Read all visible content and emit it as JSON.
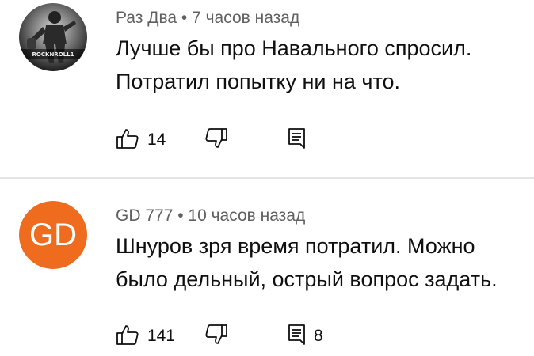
{
  "comments": [
    {
      "author": "Раз Два",
      "separator": "•",
      "time": "7 часов назад",
      "text": "Лучше бы про Навального спросил. Потратил попытку ни на что.",
      "likes": "14",
      "replies": "",
      "avatar": {
        "type": "image",
        "caption": "ROCKNROLL1"
      }
    },
    {
      "author": "GD 777",
      "separator": "•",
      "time": "10 часов назад",
      "text": "Шнуров зря время потратил. Можно было дельный, острый вопрос задать.",
      "likes": "141",
      "replies": "8",
      "avatar": {
        "type": "initials",
        "initials": "GD",
        "color": "#ef6c1f"
      }
    }
  ],
  "icons": {
    "like": "thumb-up-icon",
    "dislike": "thumb-down-icon",
    "reply": "comment-icon"
  }
}
